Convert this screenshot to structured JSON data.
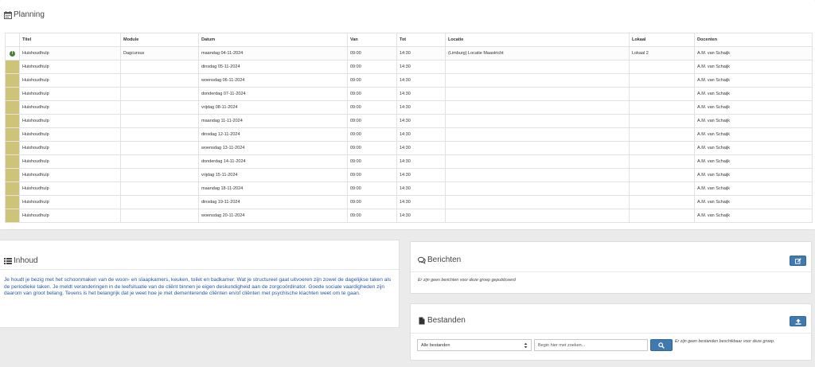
{
  "planning": {
    "title": "Planning",
    "columns": [
      "Titel",
      "Module",
      "Datum",
      "Van",
      "Tot",
      "Locatie",
      "Lokaal",
      "Docenten"
    ],
    "rows": [
      {
        "titel": "Huishoudhulp",
        "module": "Dagcursus",
        "datum": "maandag 04-11-2024",
        "van": "09:00",
        "tot": "14:30",
        "locatie": "(Limburg) Locatie Maastricht",
        "lokaal": "Lokaal 2",
        "docenten": "A.M. van Schaijk"
      },
      {
        "titel": "Huishoudhulp",
        "module": "",
        "datum": "dinsdag 05-11-2024",
        "van": "09:00",
        "tot": "14:30",
        "locatie": "",
        "lokaal": "",
        "docenten": "A.M. van Schaijk"
      },
      {
        "titel": "Huishoudhulp",
        "module": "",
        "datum": "woensdag 06-11-2024",
        "van": "09:00",
        "tot": "14:30",
        "locatie": "",
        "lokaal": "",
        "docenten": "A.M. van Schaijk"
      },
      {
        "titel": "Huishoudhulp",
        "module": "",
        "datum": "donderdag 07-11-2024",
        "van": "09:00",
        "tot": "14:30",
        "locatie": "",
        "lokaal": "",
        "docenten": "A.M. van Schaijk"
      },
      {
        "titel": "Huishoudhulp",
        "module": "",
        "datum": "vrijdag 08-11-2024",
        "van": "09:00",
        "tot": "14:30",
        "locatie": "",
        "lokaal": "",
        "docenten": "A.M. van Schaijk"
      },
      {
        "titel": "Huishoudhulp",
        "module": "",
        "datum": "maandag 11-11-2024",
        "van": "09:00",
        "tot": "14:30",
        "locatie": "",
        "lokaal": "",
        "docenten": "A.M. van Schaijk"
      },
      {
        "titel": "Huishoudhulp",
        "module": "",
        "datum": "dinsdag 12-11-2024",
        "van": "09:00",
        "tot": "14:30",
        "locatie": "",
        "lokaal": "",
        "docenten": "A.M. van Schaijk"
      },
      {
        "titel": "Huishoudhulp",
        "module": "",
        "datum": "woensdag 13-11-2024",
        "van": "09:00",
        "tot": "14:30",
        "locatie": "",
        "lokaal": "",
        "docenten": "A.M. van Schaijk"
      },
      {
        "titel": "Huishoudhulp",
        "module": "",
        "datum": "donderdag 14-11-2024",
        "van": "09:00",
        "tot": "14:30",
        "locatie": "",
        "lokaal": "",
        "docenten": "A.M. van Schaijk"
      },
      {
        "titel": "Huishoudhulp",
        "module": "",
        "datum": "vrijdag 15-11-2024",
        "van": "09:00",
        "tot": "14:30",
        "locatie": "",
        "lokaal": "",
        "docenten": "A.M. van Schaijk"
      },
      {
        "titel": "Huishoudhulp",
        "module": "",
        "datum": "maandag 18-11-2024",
        "van": "09:00",
        "tot": "14:30",
        "locatie": "",
        "lokaal": "",
        "docenten": "A.M. van Schaijk"
      },
      {
        "titel": "Huishoudhulp",
        "module": "",
        "datum": "dinsdag 19-11-2024",
        "van": "09:00",
        "tot": "14:30",
        "locatie": "",
        "lokaal": "",
        "docenten": "A.M. van Schaijk"
      },
      {
        "titel": "Huishoudhulp",
        "module": "",
        "datum": "woensdag 20-11-2024",
        "van": "09:00",
        "tot": "14:30",
        "locatie": "",
        "lokaal": "",
        "docenten": "A.M. van Schaijk"
      }
    ]
  },
  "inhoud": {
    "title": "Inhoud",
    "text": "Je houdt je bezig met het schoonmaken van de woon- en slaapkamers, keuken, toilet en badkamer. Wat je structureel gaat uitvoeren zijn zowel de dagelijkse taken als de periodieke taken. Je meldt veranderingen in de leefsituatie van de cliënt binnen je eigen deskundigheid aan de zorgcoördinator. Goede sociale vaardigheden zijn daarom van groot belang. Tevens is het belangrijk dat je weet hoe je met dementerende cliënten en/of cliënten met psychische klachten weet om te gaan."
  },
  "berichten": {
    "title": "Berichten",
    "empty_text": "Er zijn geen berichten voor deze groep gepubliceerd"
  },
  "bestanden": {
    "title": "Bestanden",
    "filter_selected": "Alle bestanden",
    "search_placeholder": "Begin hier met zoeken...",
    "empty_text": "Er zijn geen bestanden beschikbaar voor deze groep."
  },
  "colors": {
    "accent": "#3f79b0",
    "status_bar": "#cdc477",
    "status_icon": "#4e7d3a",
    "content_text": "#2a56a0"
  },
  "icons": {
    "planning": "calendar-icon",
    "inhoud": "list-icon",
    "berichten": "comments-icon",
    "bestanden": "file-icon",
    "berichten_button": "edit-icon",
    "bestanden_button": "upload-icon",
    "search_button": "search-icon",
    "status": "exclamation-circle-icon"
  }
}
